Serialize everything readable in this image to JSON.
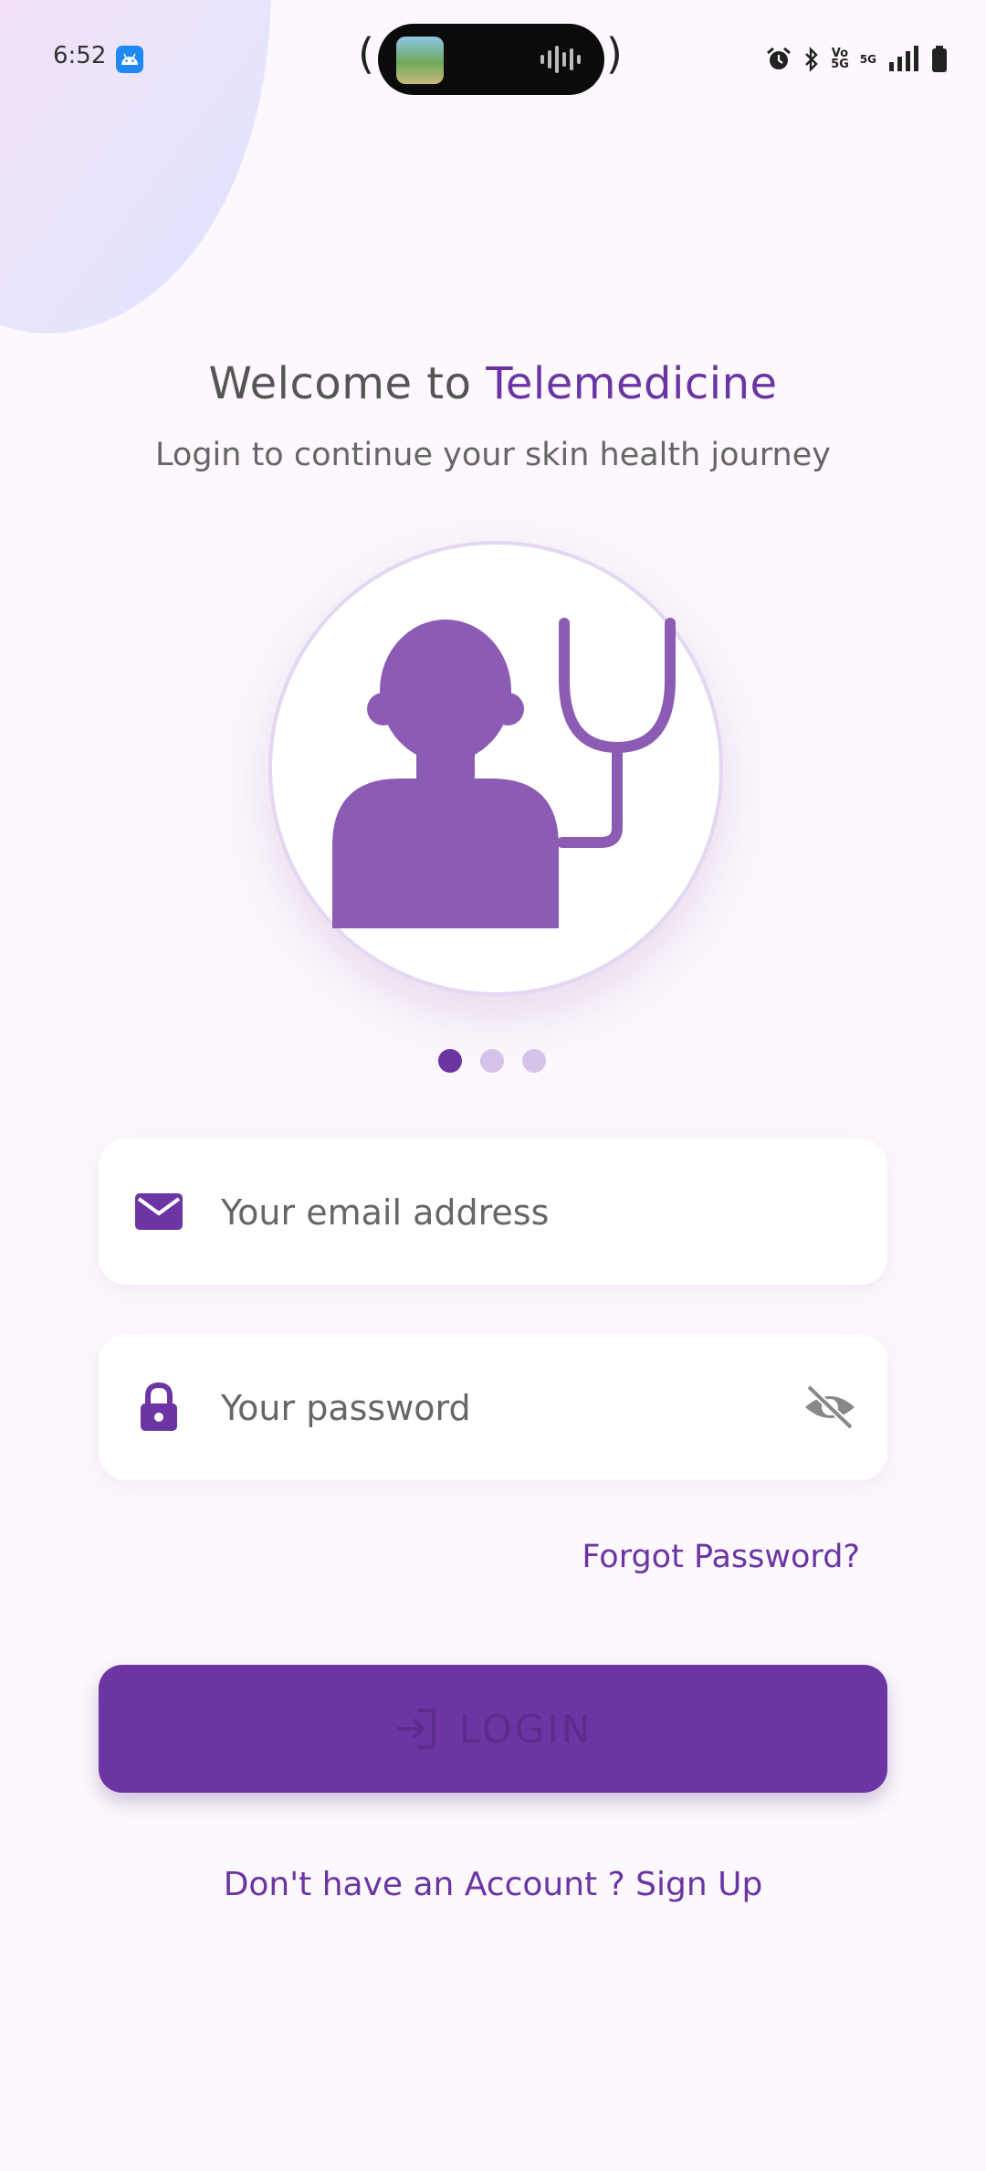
{
  "status_bar": {
    "time": "6:52",
    "app_icon": "android-icon",
    "vo5g_label": "Vo\n5G",
    "signal_label": "5G"
  },
  "header": {
    "welcome_prefix": "Welcome to ",
    "brand": "Telemedicine",
    "subtitle": "Login to continue your skin health journey"
  },
  "carousel": {
    "illustration": "doctor-stethoscope-icon",
    "page_count": 3,
    "active_index": 0
  },
  "form": {
    "email_placeholder": "Your email address",
    "password_placeholder": "Your password",
    "forgot_password": "Forgot Password?",
    "login_label": "LOGIN"
  },
  "footer": {
    "signup_text": "Don't have an Account ? Sign Up"
  },
  "colors": {
    "primary": "#6d35a3",
    "illustration": "#8c5cb5",
    "background": "#fdf8fd"
  }
}
